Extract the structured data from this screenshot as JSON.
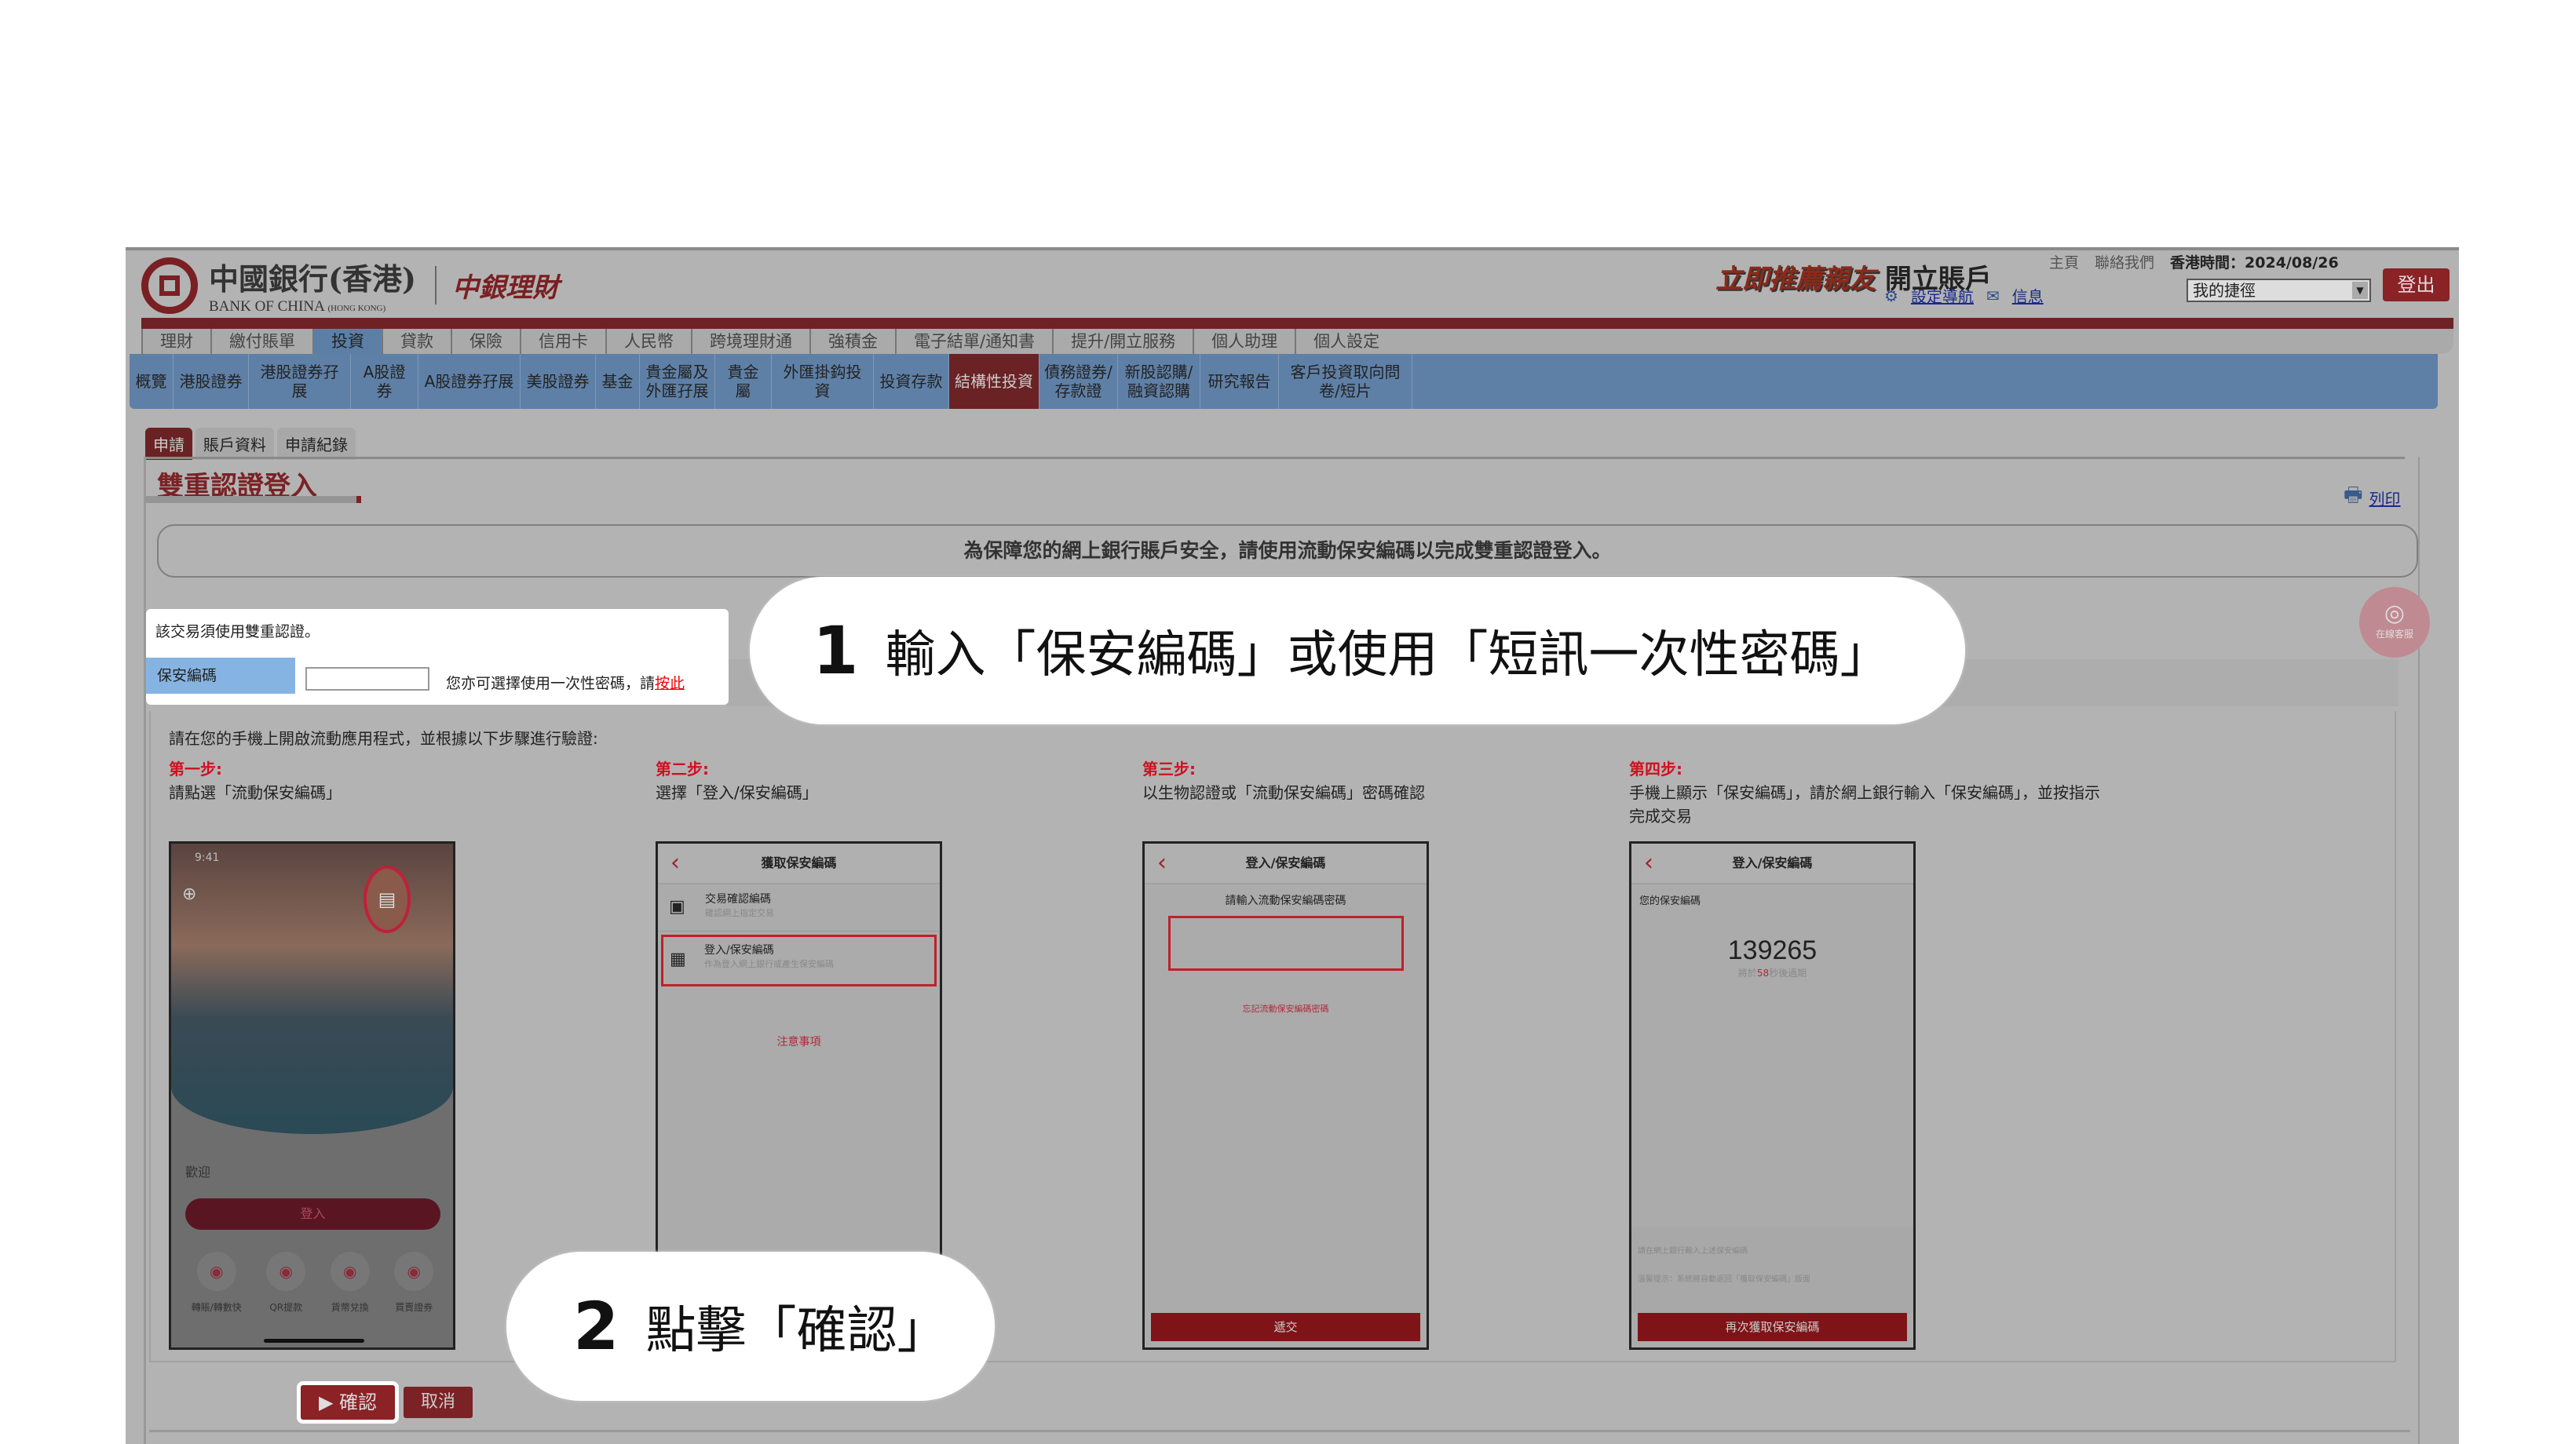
{
  "header": {
    "bank_name_cn": "中國銀行(香港)",
    "bank_name_en": "BANK OF CHINA",
    "bank_name_en_small": "(HONG KONG)",
    "wealth_logo": "中銀理財",
    "promo_highlight": "立即推薦親友",
    "promo_text": "開立賬戶",
    "home": "主頁",
    "contact": "聯絡我們",
    "time": "香港時間：2024/08/26",
    "nav_setting": "設定導航",
    "messages": "信息",
    "shortcut": "我的捷徑",
    "logout": "登出"
  },
  "main_nav": [
    "理財",
    "繳付賬單",
    "投資",
    "貸款",
    "保險",
    "信用卡",
    "人民幣",
    "跨境理財通",
    "強積金",
    "電子結單/通知書",
    "提升/開立服務",
    "個人助理",
    "個人設定"
  ],
  "main_nav_active": "投資",
  "sub_nav": [
    "概覽",
    "港股證券",
    "港股證券孖展",
    "A股證券",
    "A股證券孖展",
    "美股證券",
    "基金",
    "貴金屬及外匯孖展",
    "貴金屬",
    "外匯掛鈎投資",
    "投資存款",
    "結構性投資",
    "債務證券/存款證",
    "新股認購/融資認購",
    "研究報告",
    "客戶投資取向問卷/短片"
  ],
  "sub_nav_active": "結構性投資",
  "tabs": [
    "申請",
    "賬戶資料",
    "申請紀錄"
  ],
  "page": {
    "title": "雙重認證登入",
    "print": "列印",
    "notice": "為保障您的網上銀行賬戶安全，請使用流動保安編碼以完成雙重認證登入。",
    "chat": "在線客服"
  },
  "auth": {
    "message": "該交易須使用雙重認證。",
    "label": "保安編碼",
    "input_value": "",
    "alt_text": "您亦可選擇使用一次性密碼，請",
    "alt_link": "按此"
  },
  "steps": {
    "intro": "請在您的手機上開啟流動應用程式，並根據以下步驟進行驗證:",
    "items": [
      {
        "heading": "第一步:",
        "desc": "請點選「流動保安編碼」"
      },
      {
        "heading": "第二步:",
        "desc": "選擇「登入/保安編碼」"
      },
      {
        "heading": "第三步:",
        "desc": "以生物認證或「流動保安編碼」密碼確認"
      },
      {
        "heading": "第四步:",
        "desc": "手機上顯示「保安編碼」，請於網上銀行輸入「保安編碼」，並按指示完成交易"
      }
    ]
  },
  "phone1": {
    "time": "9:41",
    "welcome": "歡迎",
    "login": "登入",
    "shortcuts": [
      "轉賬/轉數快",
      "QR提款",
      "貨幣兌換",
      "買賣證券"
    ]
  },
  "phone2": {
    "title": "獲取保安編碼",
    "item1": "交易確認編碼",
    "item1_sub": "確認網上指定交易",
    "item2": "登入/保安編碼",
    "item2_sub": "作為登入網上銀行或產生保安編碼",
    "notes": "注意事項"
  },
  "phone3": {
    "title": "登入/保安編碼",
    "prompt": "請輸入流動保安編碼密碼",
    "forgot": "忘記流動保安編碼密碼",
    "submit": "遞交"
  },
  "phone4": {
    "title": "登入/保安編碼",
    "label": "您的保安編碼",
    "code": "139265",
    "expiry_pre": "將於",
    "expiry_sec": "58",
    "expiry_post": "秒後過期",
    "hint1": "請在網上銀行輸入上述保安編碼",
    "hint2": "溫馨提示：系統將自動返回「獲取保安編碼」版面",
    "again": "再次獲取保安編碼"
  },
  "buttons": {
    "confirm": "確認",
    "cancel": "取消"
  },
  "callouts": {
    "c1_num": "1",
    "c1_text": "輸入「保安編碼」或使用「短訊一次性密碼」",
    "c2_num": "2",
    "c2_text": "點擊「確認」"
  },
  "colors": {
    "brand_red": "#7a2226",
    "nav_blue": "#5f80a6",
    "step_red": "#d01020"
  }
}
